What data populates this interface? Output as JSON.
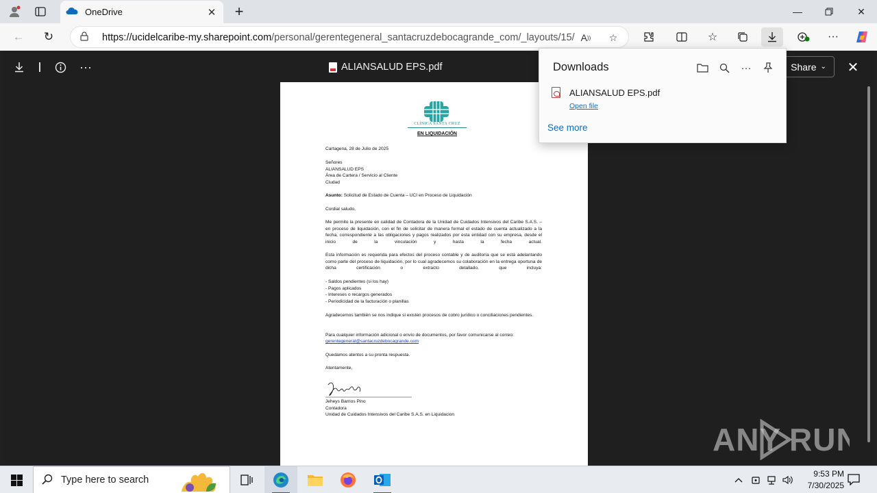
{
  "browser": {
    "tab_title": "OneDrive",
    "url_host": "https://ucidelcaribe-my.sharepoint.com",
    "url_path": "/personal/gerentegeneral_santacruzdebocagrande_com/_layouts/15/..."
  },
  "viewer": {
    "file_name": "ALIANSALUD EPS.pdf",
    "share_label": "Share"
  },
  "downloads": {
    "title": "Downloads",
    "file_name": "ALIANSALUD EPS.pdf",
    "open_file": "Open file",
    "see_more": "See more"
  },
  "letter": {
    "logo_text": "CLÍNICA SANTA CRUZ",
    "status": "EN LIQUIDACIÓN",
    "date": "Cartagena, 28 de Julio de 2025",
    "recipient": [
      "Señores",
      "ALIANSALUD EPS",
      "Área de Cartera / Servicio al Cliente",
      "Ciudad"
    ],
    "subject_label": "Asunto:",
    "subject": " Solicitud de Estado de Cuenta – UCI en Proceso de Liquidación",
    "greeting": "Cordial saludo,",
    "para1": "Me permito la presente en calidad de Contadora de la Unidad de Cuidados Intensivos del Caribe S.A.S. – en proceso de liquidación, con el fin de solicitar de manera formal el estado de cuenta actualizado a la fecha, correspondiente a las obligaciones y pagos realizados por esta entidad con su empresa, desde el inicio de la vinculación y hasta la fecha actual.",
    "para2": "Esta información es requerida para efectos del proceso contable y de auditoría que se está adelantando como parte del proceso de liquidación, por lo cual agradecemos su colaboración en la entrega oportuna de dicha certificación o extracto detallado, que incluya:",
    "bullets": [
      "- Saldos pendientes (si los hay)",
      "- Pagos aplicados",
      "- Intereses o recargos generados",
      "- Periodicidad de la facturación o planillas"
    ],
    "para3": "Agradecemos también se nos indique si existen procesos de cobro jurídico o conciliaciones pendientes.",
    "para4": "Para cualquier información adicional o envío de documentos, por favor comunicarse al correo:",
    "email": "gerentegeneral@santacruzdebocagrande.com",
    "closing1": "Quedamos atentos a su pronta respuesta.",
    "closing2": "Atentamente,",
    "signer_name": "Jeheys Barrios Pino",
    "signer_role": "Contadora",
    "signer_org": "Unidad de Cuidados Intensivos del Caribe S.A.S. en Liquidacion"
  },
  "watermark": "ANY RUN",
  "taskbar": {
    "search_placeholder": "Type here to search",
    "time": "9:53 PM",
    "date": "7/30/2025"
  },
  "colors": {
    "accent": "#0067c0",
    "link": "#0f6cbd",
    "viewer_bg": "#1f1f1f",
    "logo_teal": "#1f8a8a"
  }
}
